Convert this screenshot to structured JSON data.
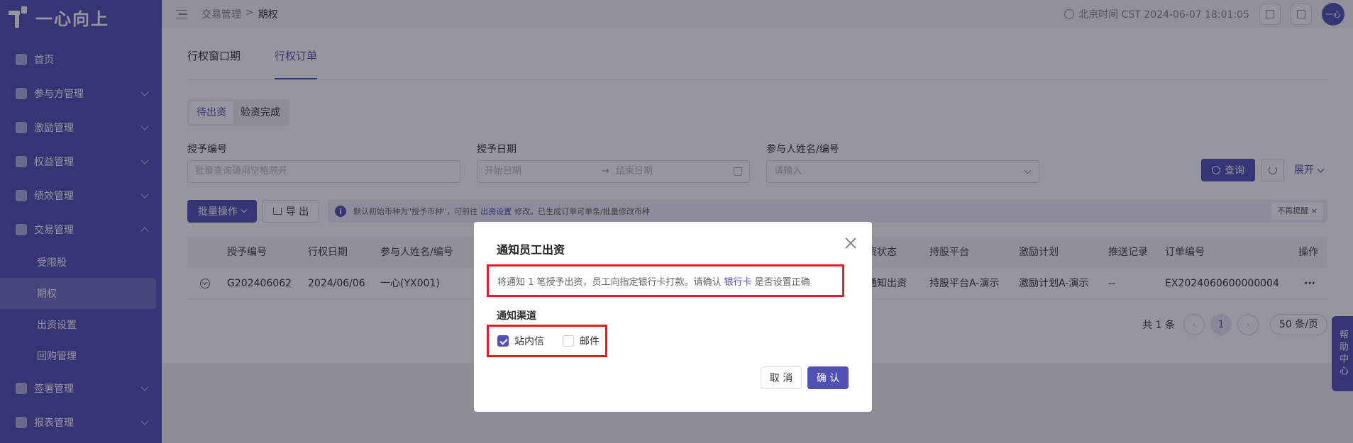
{
  "app": {
    "logo_text": "一心向上"
  },
  "sidebar": {
    "items": [
      {
        "label": "首页",
        "icon": "home-icon"
      },
      {
        "label": "参与方管理",
        "icon": "users-icon"
      },
      {
        "label": "激励管理",
        "icon": "incentive-icon"
      },
      {
        "label": "权益管理",
        "icon": "equity-icon"
      },
      {
        "label": "绩效管理",
        "icon": "performance-icon"
      },
      {
        "label": "交易管理",
        "icon": "shield-icon"
      }
    ],
    "sub_items": [
      "受限股",
      "期权",
      "出资设置",
      "回购管理"
    ],
    "items_after": [
      {
        "label": "签署管理",
        "icon": "sign-icon"
      },
      {
        "label": "报表管理",
        "icon": "report-icon"
      }
    ]
  },
  "header": {
    "breadcrumb": [
      "交易管理",
      ">",
      "期权"
    ],
    "clock": "北京时间 CST 2024-06-07 18:01:05",
    "avatar": "一心"
  },
  "main": {
    "tabs": [
      "行权窗口期",
      "行权订单"
    ],
    "segments": [
      "待出资",
      "验资完成"
    ],
    "filters": {
      "grant_no": {
        "label": "授予编号",
        "placeholder": "批量查询请用空格隔开"
      },
      "grant_date": {
        "label": "授予日期",
        "start": "开始日期",
        "arrow": "→",
        "end": "结束日期"
      },
      "participant": {
        "label": "参与人姓名/编号",
        "placeholder": "请输入"
      }
    },
    "query_label": "查询",
    "expand_label": "展开",
    "batch_label": "批量操作",
    "export_label": "导 出",
    "notice": {
      "prefix": "默认初始币种为\"授予币种\"，可前往",
      "link": "出资设置",
      "suffix": "修改。已生成订单可单条/批量修改币种",
      "dismiss": "不再提醒 ×"
    },
    "table": {
      "headers": [
        "授予编号",
        "行权日期",
        "参与人姓名/编号",
        "资状态",
        "持股平台",
        "激励计划",
        "推送记录",
        "订单编号",
        "操作"
      ],
      "rows": [
        [
          "G202406062",
          "2024/06/06",
          "一心(YX001)",
          "通知出资",
          "持股平台A-演示",
          "激励计划A-演示",
          "--",
          "EX2024060600000004",
          "···"
        ]
      ]
    },
    "pager": {
      "total": "共 1 条",
      "page": "1",
      "size": "50 条/页"
    },
    "help": "帮助中心"
  },
  "modal": {
    "title": "通知员工出资",
    "message_prefix": "将通知 1 笔授予出资，员工向指定银行卡打款。请确认",
    "message_link": "银行卡",
    "message_suffix": "是否设置正确",
    "channel_label": "通知渠道",
    "channels": [
      {
        "label": "站内信",
        "checked": true
      },
      {
        "label": "邮件",
        "checked": false
      }
    ],
    "cancel": "取 消",
    "confirm": "确 认"
  },
  "colors": {
    "brand": "#5150b5",
    "highlight_border": "#e02020"
  }
}
